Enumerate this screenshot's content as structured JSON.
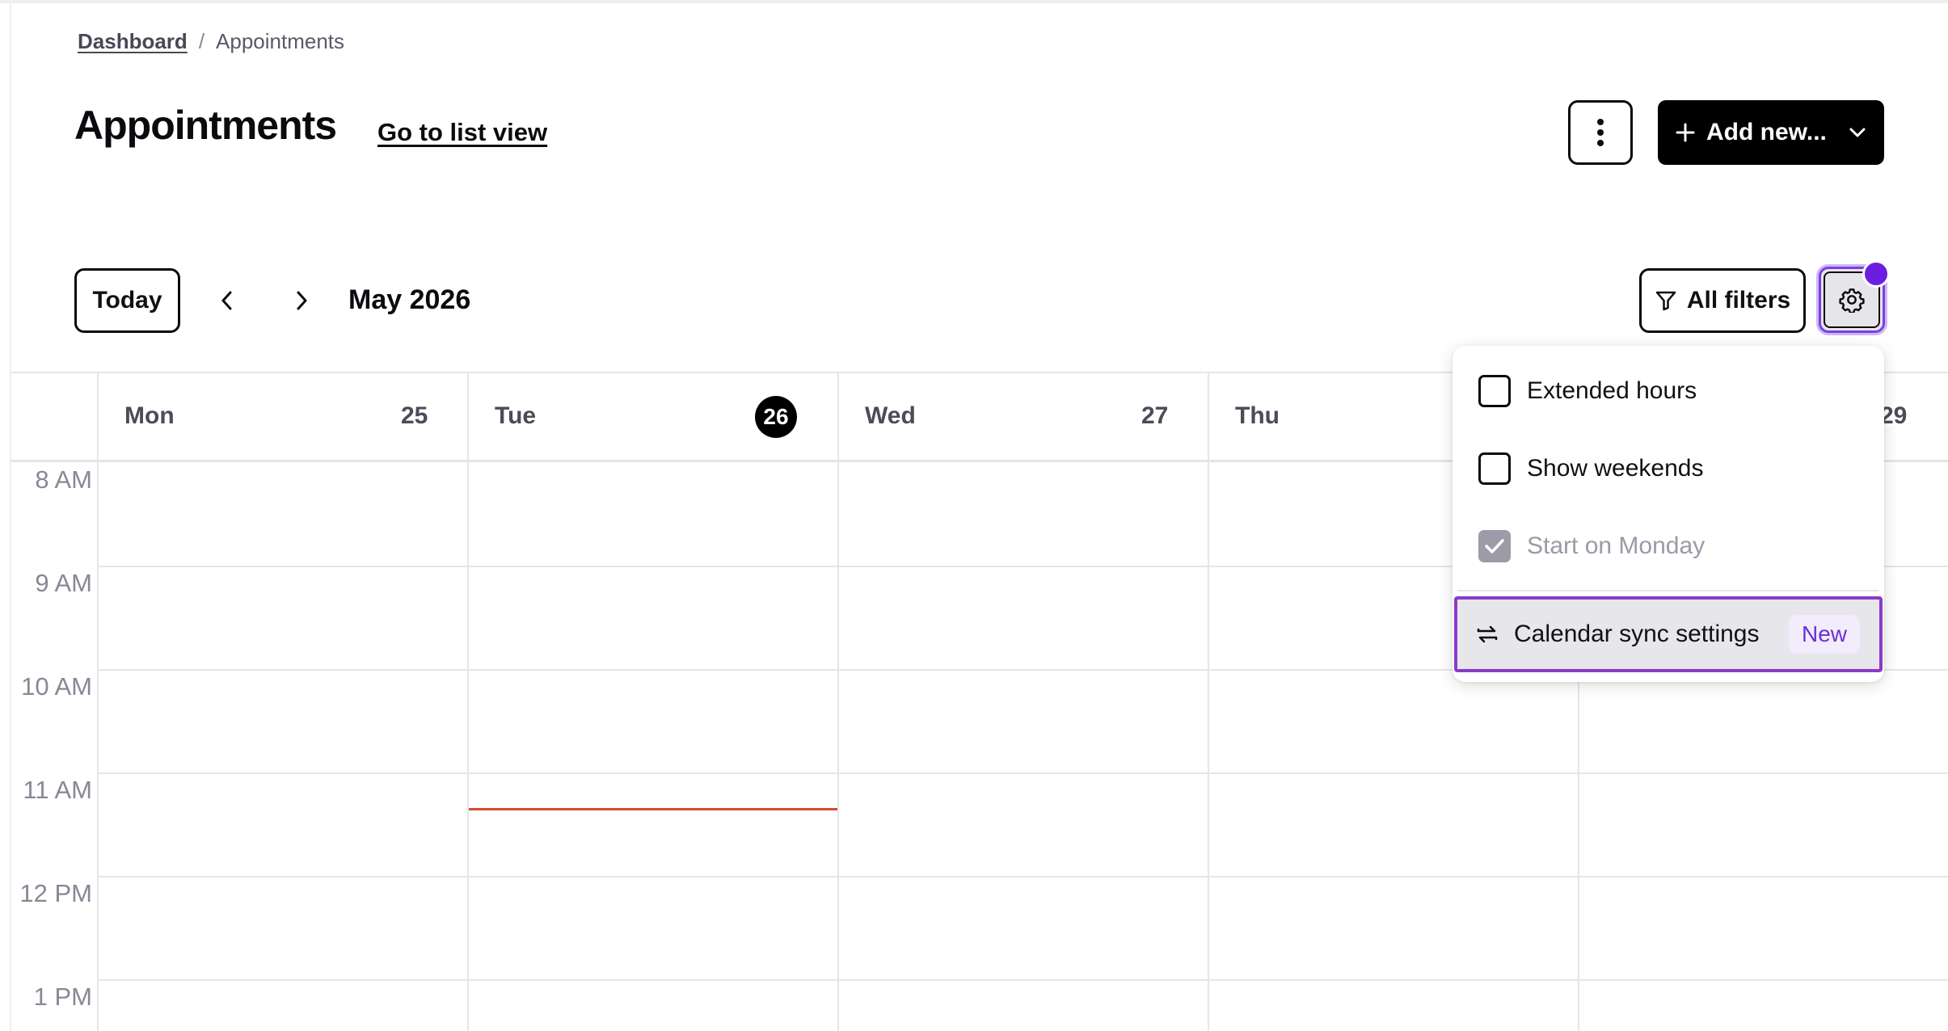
{
  "breadcrumb": {
    "parent": "Dashboard",
    "separator": "/",
    "current": "Appointments"
  },
  "header": {
    "title": "Appointments",
    "list_view_link": "Go to list view",
    "add_button_label": "Add new...",
    "more_icon": "more-vertical-icon",
    "add_icon": "plus-icon",
    "add_chevron_icon": "chevron-down-icon"
  },
  "toolbar": {
    "today_label": "Today",
    "prev_icon": "chevron-left-icon",
    "next_icon": "chevron-right-icon",
    "month": "May 2026",
    "filters_label": "All filters",
    "filter_icon": "filter-icon",
    "settings_icon": "gear-icon",
    "notification_dot_color": "#6c1ee0"
  },
  "calendar": {
    "days": [
      {
        "name": "Mon",
        "date": "25",
        "is_today": false
      },
      {
        "name": "Tue",
        "date": "26",
        "is_today": true
      },
      {
        "name": "Wed",
        "date": "27",
        "is_today": false
      },
      {
        "name": "Thu",
        "date": "",
        "is_today": false
      },
      {
        "name": "",
        "date": "29",
        "is_today": false
      }
    ],
    "hours": [
      "8 AM",
      "9 AM",
      "10 AM",
      "11 AM",
      "12 PM",
      "1 PM"
    ],
    "now_indicator_color": "#d64a32"
  },
  "settings_menu": {
    "items": [
      {
        "label": "Extended hours",
        "checked": false,
        "disabled": false
      },
      {
        "label": "Show weekends",
        "checked": false,
        "disabled": false
      },
      {
        "label": "Start on Monday",
        "checked": true,
        "disabled": true
      }
    ],
    "sync": {
      "label": "Calendar sync settings",
      "badge": "New",
      "icon": "sync-arrows-icon"
    },
    "accent_color": "#8a3bc9"
  }
}
